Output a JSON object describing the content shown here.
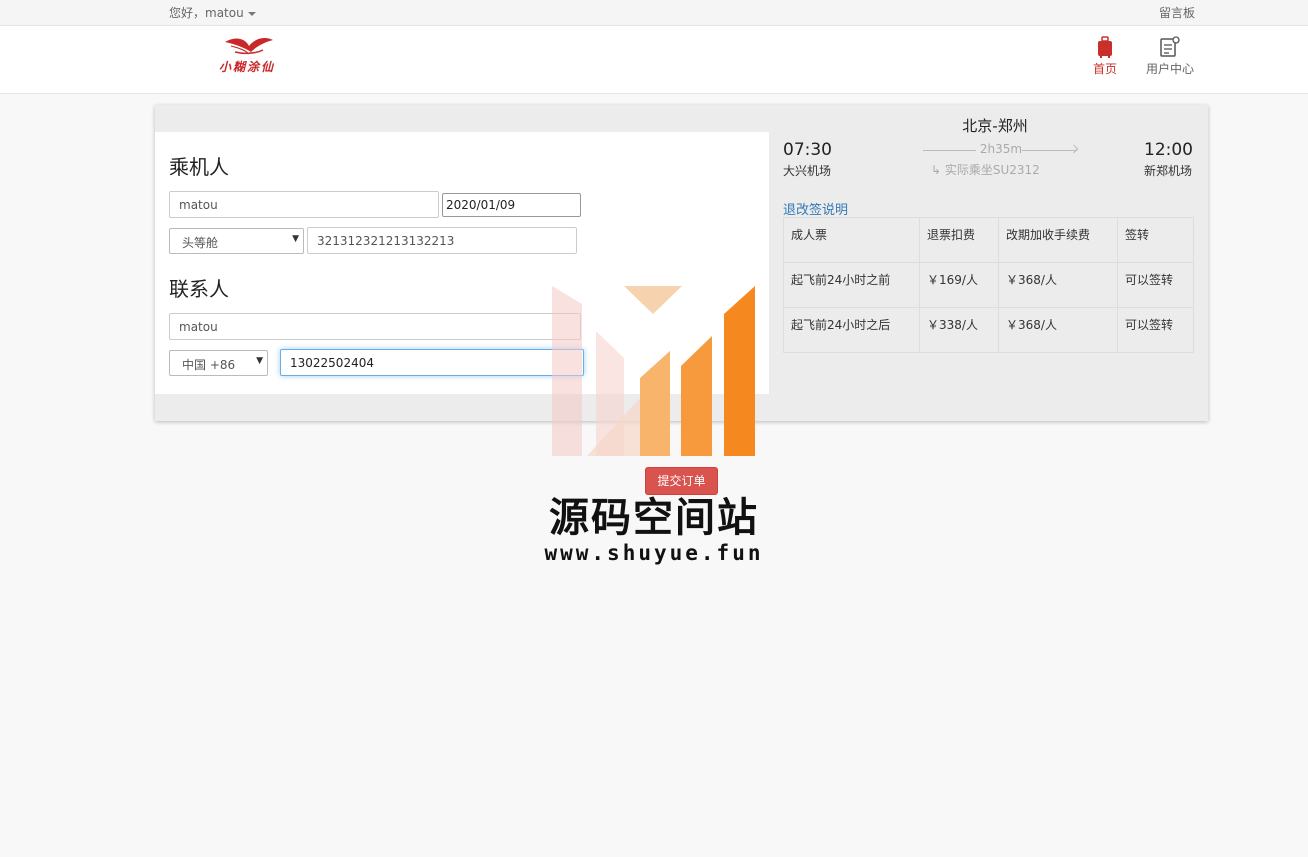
{
  "topbar": {
    "greeting": "您好，matou",
    "guestbook": "留言板"
  },
  "header": {
    "logo_text": "小糊涂仙",
    "nav": [
      {
        "label": "首页",
        "icon": "luggage-icon",
        "active": true
      },
      {
        "label": "用户中心",
        "icon": "user-edit-icon",
        "active": false
      }
    ]
  },
  "passenger": {
    "title": "乘机人",
    "name_value": "matou",
    "date_value": "2020/01/09",
    "cabin_selected": "头等舱",
    "id_value": "321312321213132213"
  },
  "contact": {
    "title": "联系人",
    "name_value": "matou",
    "country_code_selected": "中国 +86",
    "phone_value": "13022502404"
  },
  "flight": {
    "route": "北京-郑州",
    "depart_time": "07:30",
    "depart_airport": "大兴机场",
    "arrive_time": "12:00",
    "arrive_airport": "新郑机场",
    "duration": "2h35m",
    "transfer": "实际乘坐SU2312"
  },
  "policy": {
    "link": "退改签说明",
    "headers": [
      "成人票",
      "退票扣费",
      "改期加收手续费",
      "签转"
    ],
    "rows": [
      [
        "起飞前24小时之前",
        "￥169/人",
        "￥368/人",
        "可以签转"
      ],
      [
        "起飞前24小时之后",
        "￥338/人",
        "￥368/人",
        "可以签转"
      ]
    ]
  },
  "submit_label": "提交订单",
  "watermark": {
    "title": "源码空间站",
    "url": "www.shuyue.fun"
  },
  "colors": {
    "accent_red": "#d9534f",
    "link_blue": "#337ab7",
    "watermark_orange": "#f5891f"
  }
}
